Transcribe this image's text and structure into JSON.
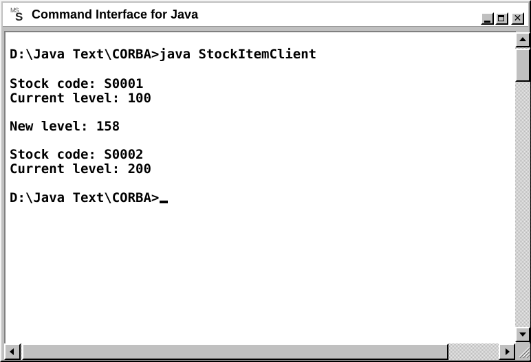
{
  "window": {
    "title": "Command Interface for Java",
    "icon": "ms-dos-prompt-icon",
    "icon_text": "MS",
    "icon_glyph": "S",
    "controls": {
      "minimize": "minimize-icon",
      "maximize": "maximize-icon",
      "close": "close-icon",
      "close_glyph": "✕"
    }
  },
  "console": {
    "lines": [
      "D:\\Java Text\\CORBA>java StockItemClient",
      "",
      "Stock code: S0001",
      "Current level: 100",
      "",
      "New level: 158",
      "",
      "Stock code: S0002",
      "Current level: 200",
      "",
      "D:\\Java Text\\CORBA>"
    ],
    "colors": {
      "background": "#ffffff",
      "text": "#000000"
    }
  },
  "scrollbars": {
    "vertical": {
      "up_icon": "arrow-up-icon",
      "down_icon": "arrow-down-icon"
    },
    "horizontal": {
      "left_icon": "arrow-left-icon",
      "right_icon": "arrow-right-icon"
    }
  }
}
